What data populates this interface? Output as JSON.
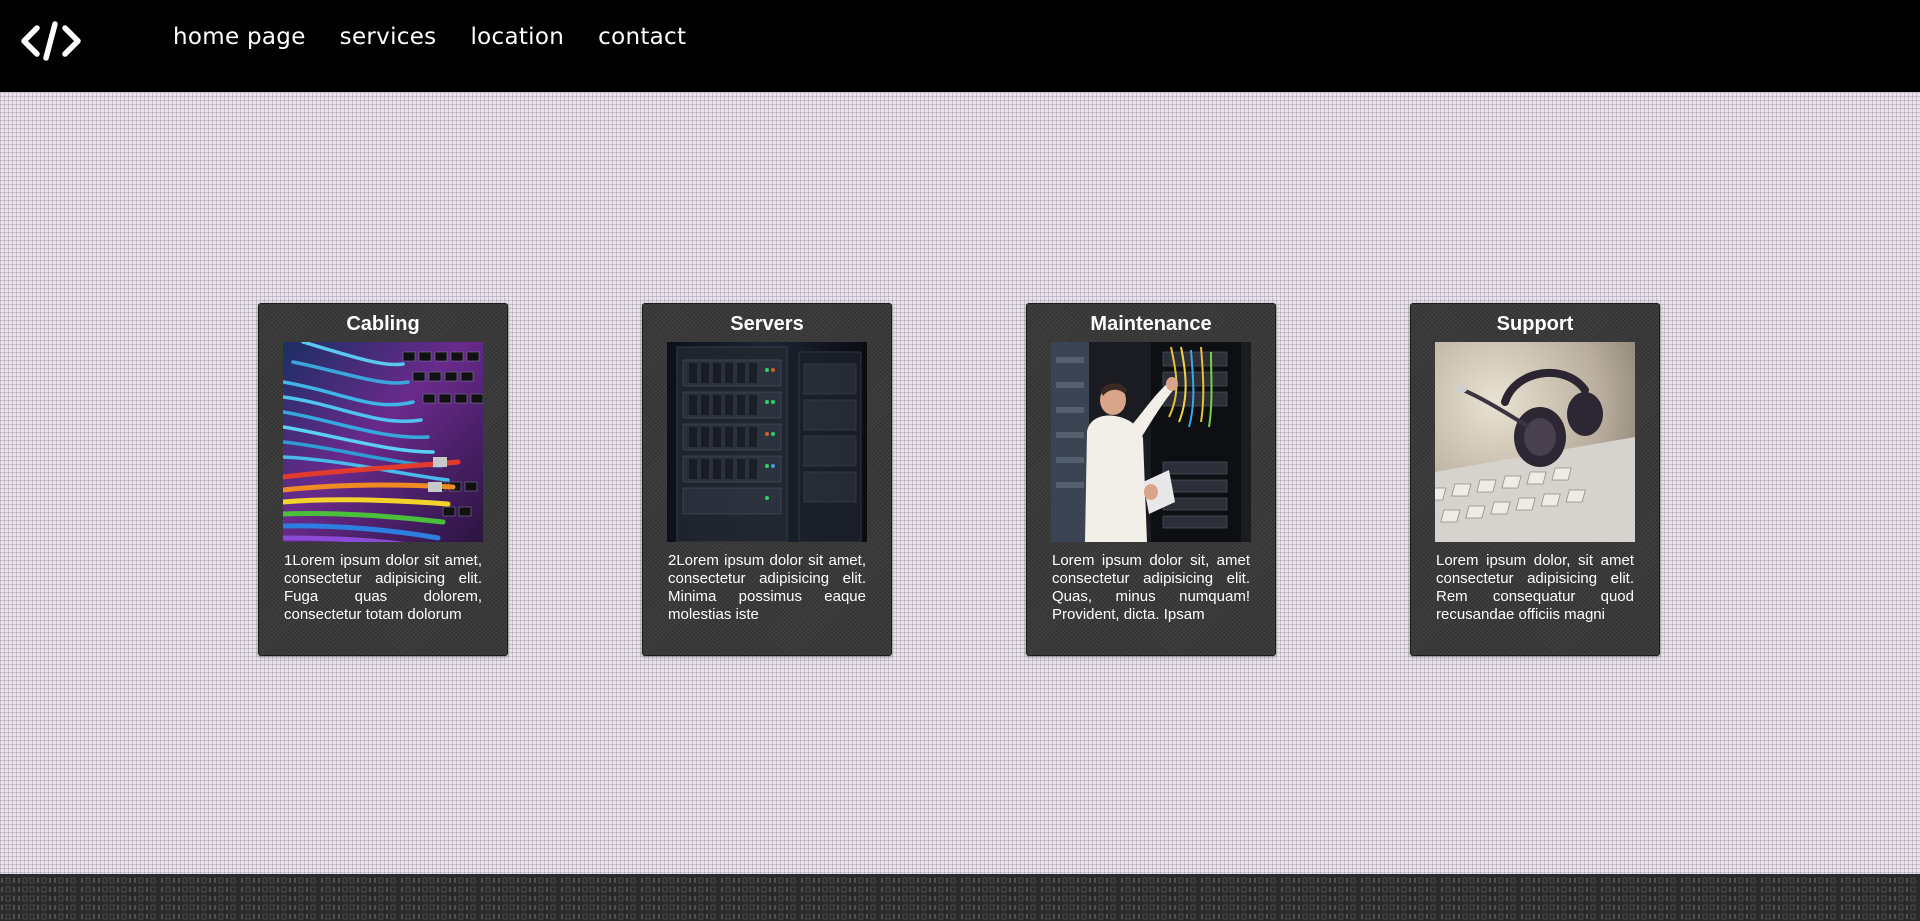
{
  "header": {
    "logo_icon": "code-brackets-icon",
    "nav": [
      {
        "label": "home page"
      },
      {
        "label": "services"
      },
      {
        "label": "location"
      },
      {
        "label": "contact"
      }
    ]
  },
  "cards": [
    {
      "title": "Cabling",
      "image": "network-cables-photo",
      "text": "1Lorem ipsum dolor sit amet, consectetur adipisicing elit. Fuga quas dolorem, consectetur totam dolorum"
    },
    {
      "title": "Servers",
      "image": "server-rack-photo",
      "text": "2Lorem ipsum dolor sit amet, consectetur adipisicing elit. Minima possimus eaque molestias iste"
    },
    {
      "title": "Maintenance",
      "image": "technician-at-rack-photo",
      "text": "Lorem ipsum dolor sit, amet consectetur adipisicing elit. Quas, minus numquam! Provident, dicta. Ipsam"
    },
    {
      "title": "Support",
      "image": "headset-on-keyboard-photo",
      "text": "Lorem ipsum dolor, sit amet consectetur adipisicing elit. Rem consequatur quod recusandae officiis magni"
    }
  ],
  "colors": {
    "header_bg": "#000000",
    "page_bg": "#e9e4ec",
    "card_bg": "#3a3a3a",
    "footer_bg": "#2a2a2a",
    "text": "#ffffff"
  }
}
